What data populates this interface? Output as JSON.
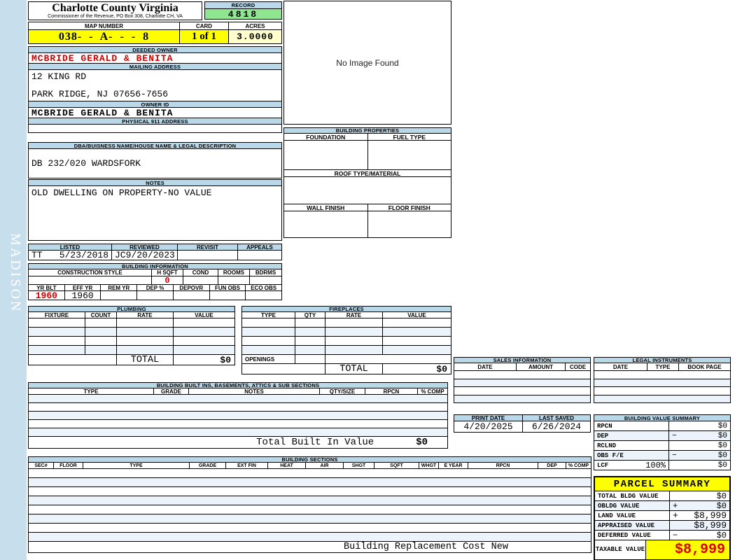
{
  "watermark": "MADISON",
  "header": {
    "county_title": "Charlotte County Virginia",
    "county_subtitle": "Commissioner of the Revenue, PO Box 308, Charlotte CH, VA",
    "record_label": "RECORD",
    "record_value": "4818",
    "map_number_label": "MAP NUMBER",
    "map_number_value": "038- - A- -  -  8",
    "card_label": "CARD",
    "card_value": "1 of 1",
    "acres_label": "ACRES",
    "acres_value": "3.0000"
  },
  "owner": {
    "deeded_owner_label": "DEEDED OWNER",
    "deeded_owner": "MCBRIDE GERALD & BENITA",
    "mailing_address_label": "MAILING ADDRESS",
    "mailing_line1": "12 KING RD",
    "mailing_line2": "PARK RIDGE, NJ 07656-7656",
    "owner_id_label": "OWNER ID",
    "owner_id": "MCBRIDE GERALD & BENITA",
    "physical_address_label": "PHYSICAL 911 ADDRESS",
    "physical_address": ""
  },
  "legal_description": {
    "dba_label": "DBA/BUISNESS NAME/HOUSE NAME & LEGAL DESCRIPTION",
    "dba_value": "DB 232/020 WARDSFORK",
    "notes_label": "NOTES",
    "notes_value": "OLD DWELLING ON PROPERTY-NO VALUE"
  },
  "visits": {
    "listed_label": "LISTED",
    "listed_initials": "TT",
    "listed_date": "5/23/2018",
    "reviewed_label": "REVIEWED",
    "reviewed_initials": "JC",
    "reviewed_date": "9/20/2023",
    "revisit_label": "REVISIT",
    "appeals_label": "APPEALS"
  },
  "building_information": {
    "title": "BUILDING INFORMATION",
    "construction_style_label": "CONSTRUCTION STYLE",
    "hsqft_label": "H SQFT",
    "hsqft_value": "0",
    "cond_label": "COND",
    "rooms_label": "ROOMS",
    "bdrms_label": "BDRMS",
    "yrblt_label": "YR BLT",
    "yrblt_value": "1960",
    "effyr_label": "EFF YR",
    "effyr_value": "1960",
    "remyr_label": "REM YR",
    "dep_label": "DEP %",
    "depovr_label": "DEPOVR",
    "funobs_label": "FUN OBS",
    "ecoobs_label": "ECO OBS"
  },
  "plumbing": {
    "title": "PLUMBING",
    "headers": [
      "FIXTURE",
      "COUNT",
      "RATE",
      "VALUE"
    ],
    "total_label": "TOTAL",
    "total_value": "$0"
  },
  "fireplaces": {
    "title": "FIREPLACES",
    "headers": [
      "TYPE",
      "QTY",
      "RATE",
      "VALUE"
    ],
    "openings_label": "OPENINGS",
    "total_label": "TOTAL",
    "total_value": "$0"
  },
  "built_ins": {
    "title": "BUILDING BUILT INS, BASEMENTS, ATTICS & SUB SECTIONS",
    "headers": [
      "TYPE",
      "GRADE",
      "NOTES",
      "QTY/SIZE",
      "RPCN",
      "% COMP"
    ],
    "total_label": "Total Built In Value",
    "total_value": "$0"
  },
  "building_sections": {
    "title": "BUILDING SECTIONS",
    "headers": [
      "SEC#",
      "FLOOR",
      "TYPE",
      "GRADE",
      "EXT FIN",
      "HEAT",
      "AIR",
      "SHGT",
      "SQFT",
      "WHGT",
      "E YEAR",
      "RPCN",
      "DEP",
      "% COMP"
    ],
    "footer_label": "Building Replacement Cost New"
  },
  "image_panel": {
    "no_image_text": "No Image Found"
  },
  "building_properties": {
    "title": "BUILDING PROPERTIES",
    "foundation_label": "FOUNDATION",
    "fuel_type_label": "FUEL TYPE",
    "roof_label": "ROOF TYPE/MATERIAL",
    "wall_finish_label": "WALL FINISH",
    "floor_finish_label": "FLOOR FINISH"
  },
  "sales_information": {
    "title": "SALES INFORMATION",
    "headers": [
      "DATE",
      "AMOUNT",
      "CODE"
    ]
  },
  "legal_instruments": {
    "title": "LEGAL INSTRUMENTS",
    "headers": [
      "DATE",
      "TYPE",
      "BOOK PAGE"
    ]
  },
  "dates": {
    "print_date_label": "PRINT DATE",
    "print_date": "4/20/2025",
    "last_saved_label": "LAST SAVED",
    "last_saved": "6/26/2024"
  },
  "building_value_summary": {
    "title": "BUILDING VALUE SUMMARY",
    "rows": [
      {
        "label": "RPCN",
        "op": "",
        "value": "$0"
      },
      {
        "label": "DEP",
        "op": "−",
        "value": "$0"
      },
      {
        "label": "RCLND",
        "op": "",
        "value": "$0"
      },
      {
        "label": "OBS F/E",
        "op": "−",
        "value": "$0"
      },
      {
        "label": "LCF",
        "pct": "100%",
        "op": "",
        "value": "$0"
      }
    ]
  },
  "parcel_summary": {
    "title": "PARCEL SUMMARY",
    "rows": [
      {
        "label": "TOTAL BLDG VALUE",
        "op": "",
        "value": "$0"
      },
      {
        "label": "OBLDG VALUE",
        "op": "+",
        "value": "$0"
      },
      {
        "label": "LAND VALUE",
        "op": "+",
        "value": "$8,999"
      },
      {
        "label": "APPRAISED VALUE",
        "op": "",
        "value": "$8,999"
      },
      {
        "label": "DEFERRED VALUE",
        "op": "−",
        "value": "$0"
      }
    ],
    "taxable_label": "TAXABLE VALUE",
    "taxable_value": "$8,999"
  },
  "colors": {
    "header_blue": "#b9d8e9",
    "page_strip_blue": "#c7dfec",
    "highlight_yellow": "#ffff00",
    "acres_cream": "#ffffcc",
    "record_green": "#8fe690",
    "value_red": "#cc0000",
    "stripe_blue": "#edf3fa"
  }
}
